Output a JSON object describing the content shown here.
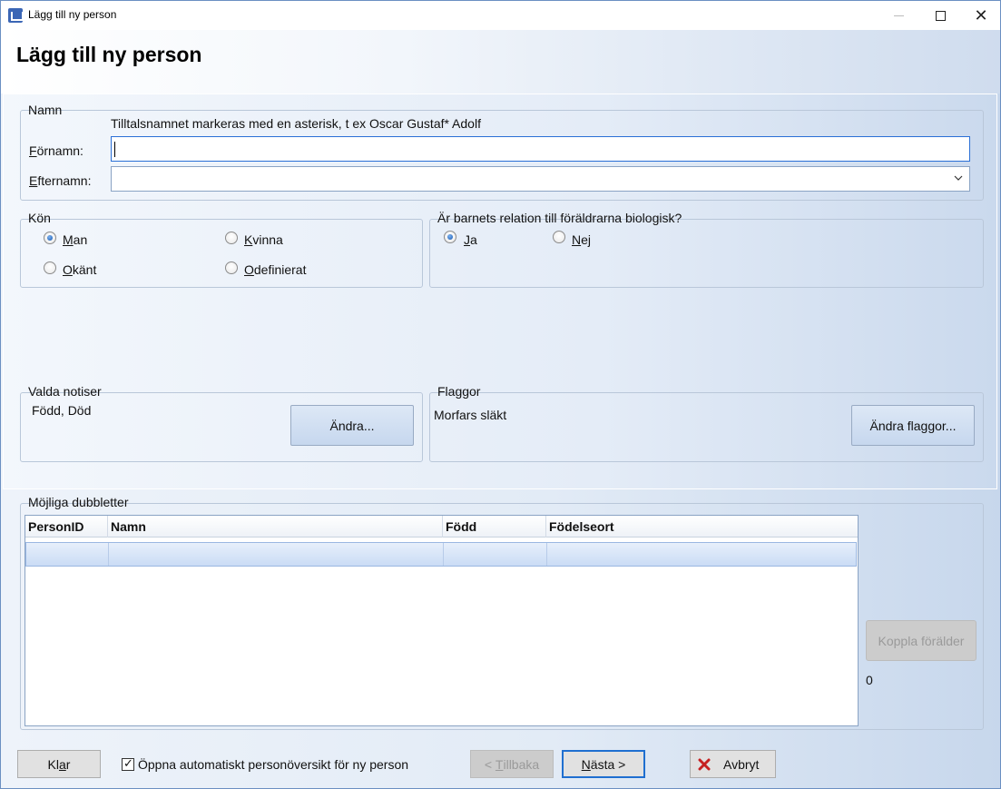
{
  "window": {
    "title": "Lägg till ny person",
    "controls": {
      "minimize": "–",
      "maximize": "□",
      "close": "✕"
    }
  },
  "header": {
    "title": "Lägg till ny person"
  },
  "namn": {
    "legend": "Namn",
    "hint": "Tilltalsnamnet markeras med en asterisk, t ex  Oscar Gustaf* Adolf",
    "fornamn_label_key": "F",
    "fornamn_label_rest": "örnamn:",
    "fornamn_value": "",
    "efternamn_label_key": "E",
    "efternamn_label_rest": "fternamn:",
    "efternamn_value": ""
  },
  "kon": {
    "legend": "Kön",
    "options": [
      {
        "key": "M",
        "rest": "an",
        "checked": true
      },
      {
        "key": "K",
        "rest": "vinna",
        "checked": false
      },
      {
        "key": "O",
        "rest": "känt",
        "checked": false
      },
      {
        "key": "O",
        "rest": "definierat",
        "checked": false
      }
    ]
  },
  "relation": {
    "legend": "Är barnets relation till föräldrarna biologisk?",
    "options": [
      {
        "key": "J",
        "rest": "a",
        "checked": true
      },
      {
        "key": "N",
        "rest": "ej",
        "checked": false
      }
    ]
  },
  "notiser": {
    "legend": "Valda notiser",
    "value": "Född, Död",
    "button": "Ändra..."
  },
  "flaggor": {
    "legend": "Flaggor",
    "value": "Morfars släkt",
    "button": "Ändra flaggor..."
  },
  "dubbletter": {
    "legend": "Möjliga dubbletter",
    "columns": [
      "PersonID",
      "Namn",
      "Född",
      "Födelseort"
    ],
    "rows": [
      [
        "",
        "",
        "",
        ""
      ]
    ],
    "koppla_button": "Koppla förälder",
    "count": "0"
  },
  "footer": {
    "klar_key": "a",
    "klar_pre": "Kl",
    "klar_post": "r",
    "checkbox_label": "Öppna automatiskt personöversikt för ny person",
    "checkbox_checked": true,
    "tillbaka_pre": "< ",
    "tillbaka_key": "T",
    "tillbaka_post": "illbaka",
    "nasta_key": "N",
    "nasta_post": "ästa >",
    "avbryt": "Avbryt"
  },
  "colors": {
    "accent": "#1f6fd0",
    "border": "#b9c7d9",
    "cancel_icon": "#c62020"
  }
}
